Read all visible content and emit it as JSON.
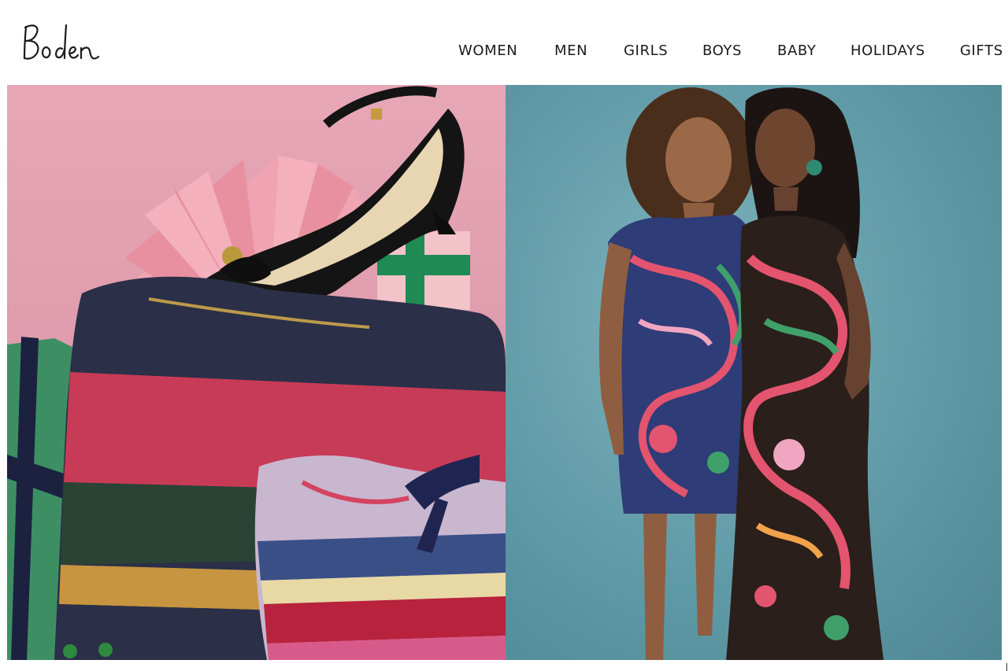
{
  "brand": {
    "logo_text": "Boden"
  },
  "nav": {
    "items": [
      {
        "label": "WOMEN"
      },
      {
        "label": "MEN"
      },
      {
        "label": "GIRLS"
      },
      {
        "label": "BOYS"
      },
      {
        "label": "BABY"
      },
      {
        "label": "HOLIDAYS"
      },
      {
        "label": "GIFTS"
      }
    ]
  },
  "hero": {
    "left_image": "knitwear-and-shoe-gift-flatlay",
    "right_image": "two-women-in-printed-dresses"
  },
  "colors": {
    "text": "#1b1b1b",
    "pink_background": "#e0a0b1",
    "teal_background": "#6ea6b1"
  }
}
